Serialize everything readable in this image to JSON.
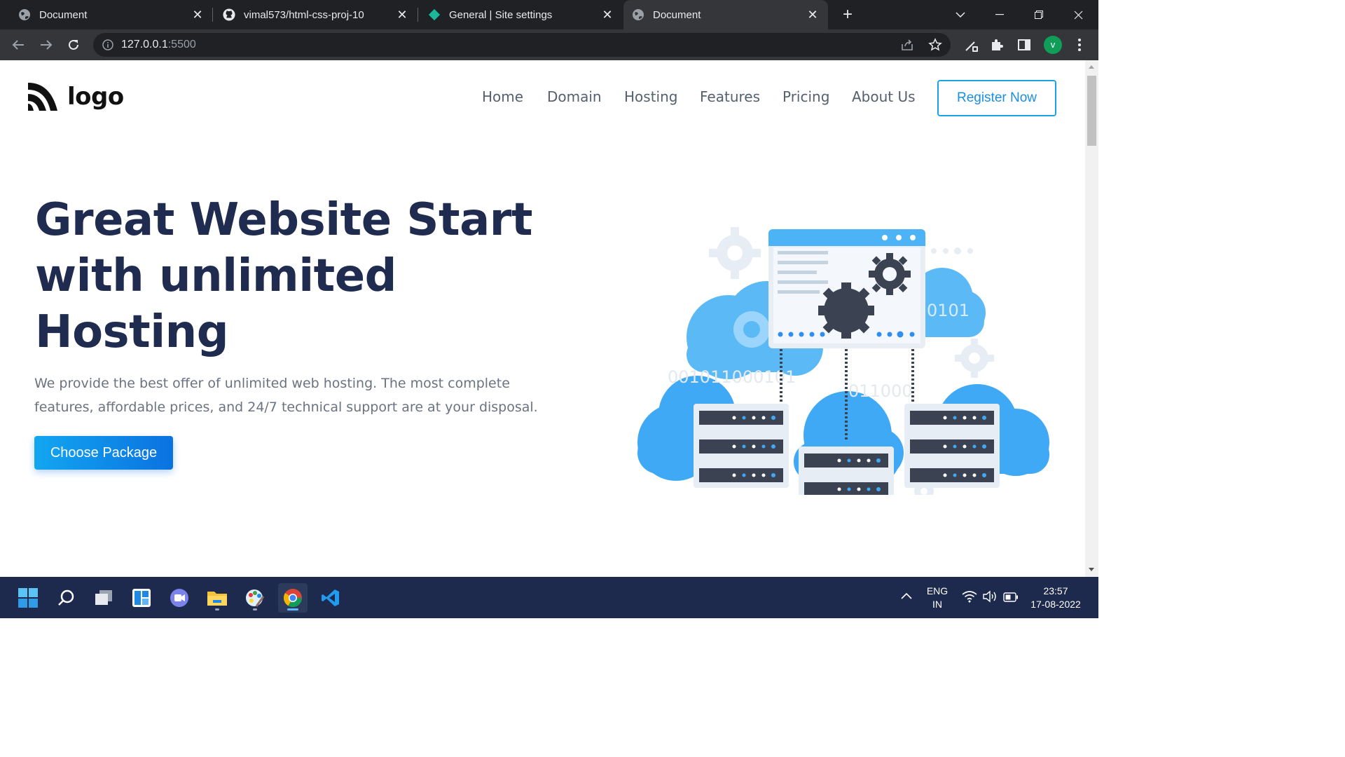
{
  "browser": {
    "tabs": [
      {
        "title": "Document",
        "favicon": "globe-icon",
        "active": false
      },
      {
        "title": "vimal573/html-css-proj-10",
        "favicon": "github-icon",
        "active": false
      },
      {
        "title": "General | Site settings",
        "favicon": "diamond-icon",
        "active": false
      },
      {
        "title": "Document",
        "favicon": "globe-icon",
        "active": true
      }
    ],
    "url_host": "127.0.0.1",
    "url_port": ":5500",
    "profile_initial": "v"
  },
  "site": {
    "logo_text": "logo",
    "nav": [
      "Home",
      "Domain",
      "Hosting",
      "Features",
      "Pricing",
      "About Us"
    ],
    "register_label": "Register Now",
    "hero": {
      "title": "Great Website Start with unlimited Hosting",
      "description": "We provide the best offer of unlimited web hosting. The most complete features, affordable prices, and 24/7 technical support are at your disposal.",
      "cta_label": "Choose Package"
    },
    "illustration_texts": [
      "0101",
      "001011000101",
      "011000",
      "0010101"
    ]
  },
  "taskbar": {
    "lang_top": "ENG",
    "lang_bottom": "IN",
    "time": "23:57",
    "date": "17-08-2022"
  },
  "colors": {
    "heading": "#1f2b4f",
    "accent": "#1aa3e8",
    "cloud": "#4db3f7",
    "server": "#3b4252"
  }
}
